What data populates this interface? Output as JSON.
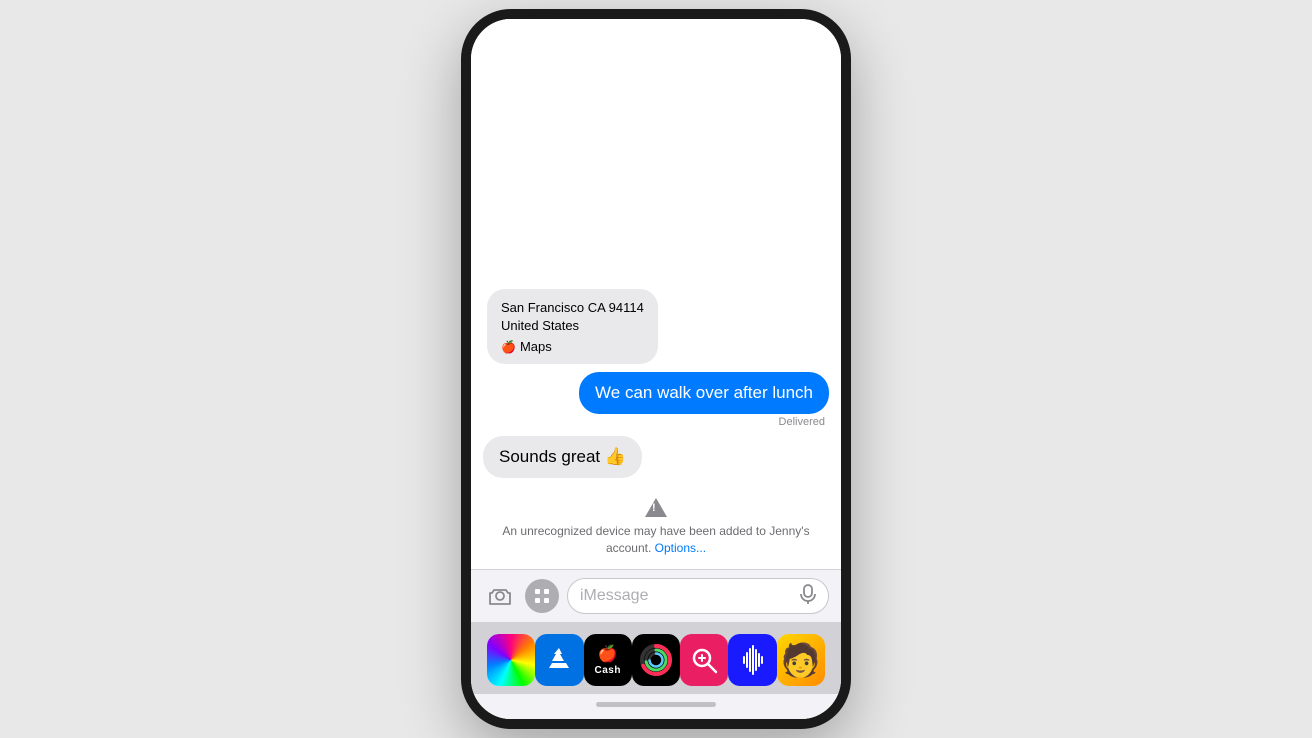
{
  "phone": {
    "messages": {
      "location_bubble": {
        "address": "San Francisco CA 94114",
        "country": "United States",
        "maps_label": "Maps"
      },
      "sent_bubble": {
        "text": "We can walk over after lunch",
        "status": "Delivered"
      },
      "received_bubble": {
        "text": "Sounds great 👍"
      },
      "warning": {
        "icon": "⚠",
        "main_text": "An unrecognized device may have been added to Jenny's account.",
        "link_text": "Options..."
      }
    },
    "input_bar": {
      "camera_icon": "⊙",
      "apps_icon": "A",
      "placeholder": "iMessage",
      "microphone_icon": "🎙"
    },
    "app_dock": {
      "apps": [
        {
          "id": "photos",
          "label": "Photos"
        },
        {
          "id": "appstore",
          "label": "App Store"
        },
        {
          "id": "cash",
          "label": "Apple Cash",
          "text1": "🍎Cash"
        },
        {
          "id": "activity",
          "label": "Activity"
        },
        {
          "id": "check",
          "label": "Check"
        },
        {
          "id": "soundwave",
          "label": "Sound Wave"
        },
        {
          "id": "memoji",
          "label": "Memoji"
        }
      ]
    },
    "home_indicator": {
      "label": "Home Indicator"
    }
  }
}
